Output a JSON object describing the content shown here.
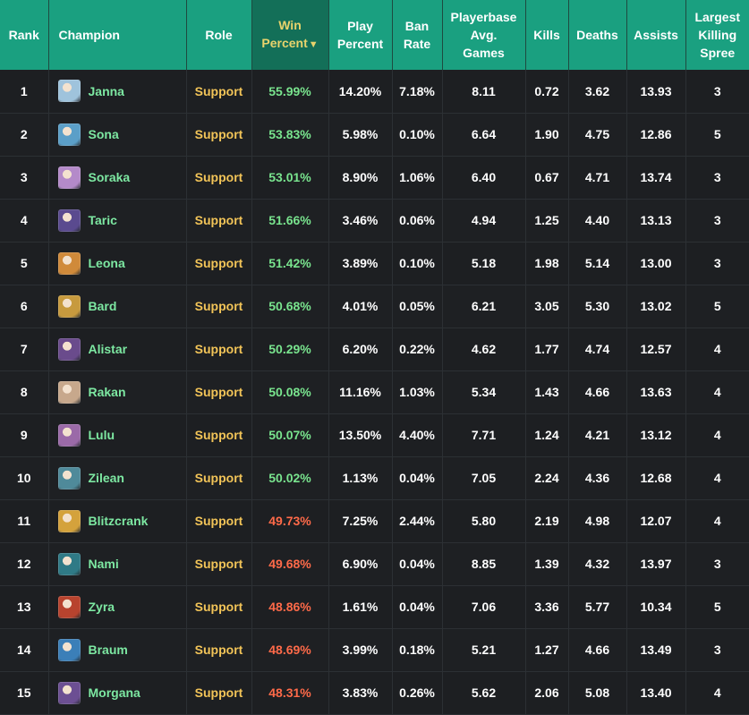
{
  "headers": {
    "rank": "Rank",
    "champion": "Champion",
    "role": "Role",
    "win_line1": "Win",
    "win_line2": "Percent",
    "win_arrow": "▼",
    "play_line1": "Play",
    "play_line2": "Percent",
    "ban_line1": "Ban",
    "ban_line2": "Rate",
    "pb_line1": "Playerbase",
    "pb_line2": "Avg.",
    "pb_line3": "Games",
    "kills": "Kills",
    "deaths": "Deaths",
    "assists": "Assists",
    "spree_line1": "Largest",
    "spree_line2": "Killing",
    "spree_line3": "Spree"
  },
  "colors": {
    "header_bg": "#1aa080",
    "sorted_header_bg": "#136f58",
    "champion_name": "#7de8a2",
    "role": "#f2c458",
    "win_high": "#79e48e",
    "win_low": "#ff6a49"
  },
  "rows": [
    {
      "rank": "1",
      "champion": "Janna",
      "role": "Support",
      "win": "55.99%",
      "win_class": "good",
      "play": "14.20%",
      "ban": "7.18%",
      "games": "8.11",
      "kills": "0.72",
      "deaths": "3.62",
      "assists": "13.93",
      "spree": "3",
      "avatar": "#9fc3dc"
    },
    {
      "rank": "2",
      "champion": "Sona",
      "role": "Support",
      "win": "53.83%",
      "win_class": "good",
      "play": "5.98%",
      "ban": "0.10%",
      "games": "6.64",
      "kills": "1.90",
      "deaths": "4.75",
      "assists": "12.86",
      "spree": "5",
      "avatar": "#5b9fc8"
    },
    {
      "rank": "3",
      "champion": "Soraka",
      "role": "Support",
      "win": "53.01%",
      "win_class": "good",
      "play": "8.90%",
      "ban": "1.06%",
      "games": "6.40",
      "kills": "0.67",
      "deaths": "4.71",
      "assists": "13.74",
      "spree": "3",
      "avatar": "#b48ac9"
    },
    {
      "rank": "4",
      "champion": "Taric",
      "role": "Support",
      "win": "51.66%",
      "win_class": "good",
      "play": "3.46%",
      "ban": "0.06%",
      "games": "4.94",
      "kills": "1.25",
      "deaths": "4.40",
      "assists": "13.13",
      "spree": "3",
      "avatar": "#5a4a8f"
    },
    {
      "rank": "5",
      "champion": "Leona",
      "role": "Support",
      "win": "51.42%",
      "win_class": "good",
      "play": "3.89%",
      "ban": "0.10%",
      "games": "5.18",
      "kills": "1.98",
      "deaths": "5.14",
      "assists": "13.00",
      "spree": "3",
      "avatar": "#d08a3a"
    },
    {
      "rank": "6",
      "champion": "Bard",
      "role": "Support",
      "win": "50.68%",
      "win_class": "good",
      "play": "4.01%",
      "ban": "0.05%",
      "games": "6.21",
      "kills": "3.05",
      "deaths": "5.30",
      "assists": "13.02",
      "spree": "5",
      "avatar": "#c79a3e"
    },
    {
      "rank": "7",
      "champion": "Alistar",
      "role": "Support",
      "win": "50.29%",
      "win_class": "good",
      "play": "6.20%",
      "ban": "0.22%",
      "games": "4.62",
      "kills": "1.77",
      "deaths": "4.74",
      "assists": "12.57",
      "spree": "4",
      "avatar": "#6a4b8c"
    },
    {
      "rank": "8",
      "champion": "Rakan",
      "role": "Support",
      "win": "50.08%",
      "win_class": "good",
      "play": "11.16%",
      "ban": "1.03%",
      "games": "5.34",
      "kills": "1.43",
      "deaths": "4.66",
      "assists": "13.63",
      "spree": "4",
      "avatar": "#c7a88c"
    },
    {
      "rank": "9",
      "champion": "Lulu",
      "role": "Support",
      "win": "50.07%",
      "win_class": "good",
      "play": "13.50%",
      "ban": "4.40%",
      "games": "7.71",
      "kills": "1.24",
      "deaths": "4.21",
      "assists": "13.12",
      "spree": "4",
      "avatar": "#9b6aa8"
    },
    {
      "rank": "10",
      "champion": "Zilean",
      "role": "Support",
      "win": "50.02%",
      "win_class": "good",
      "play": "1.13%",
      "ban": "0.04%",
      "games": "7.05",
      "kills": "2.24",
      "deaths": "4.36",
      "assists": "12.68",
      "spree": "4",
      "avatar": "#4f8a9a"
    },
    {
      "rank": "11",
      "champion": "Blitzcrank",
      "role": "Support",
      "win": "49.73%",
      "win_class": "bad",
      "play": "7.25%",
      "ban": "2.44%",
      "games": "5.80",
      "kills": "2.19",
      "deaths": "4.98",
      "assists": "12.07",
      "spree": "4",
      "avatar": "#d4a23c"
    },
    {
      "rank": "12",
      "champion": "Nami",
      "role": "Support",
      "win": "49.68%",
      "win_class": "bad",
      "play": "6.90%",
      "ban": "0.04%",
      "games": "8.85",
      "kills": "1.39",
      "deaths": "4.32",
      "assists": "13.97",
      "spree": "3",
      "avatar": "#2f7a86"
    },
    {
      "rank": "13",
      "champion": "Zyra",
      "role": "Support",
      "win": "48.86%",
      "win_class": "bad",
      "play": "1.61%",
      "ban": "0.04%",
      "games": "7.06",
      "kills": "3.36",
      "deaths": "5.77",
      "assists": "10.34",
      "spree": "5",
      "avatar": "#b8432e"
    },
    {
      "rank": "14",
      "champion": "Braum",
      "role": "Support",
      "win": "48.69%",
      "win_class": "bad",
      "play": "3.99%",
      "ban": "0.18%",
      "games": "5.21",
      "kills": "1.27",
      "deaths": "4.66",
      "assists": "13.49",
      "spree": "3",
      "avatar": "#3b7fb8"
    },
    {
      "rank": "15",
      "champion": "Morgana",
      "role": "Support",
      "win": "48.31%",
      "win_class": "bad",
      "play": "3.83%",
      "ban": "0.26%",
      "games": "5.62",
      "kills": "2.06",
      "deaths": "5.08",
      "assists": "13.40",
      "spree": "4",
      "avatar": "#6c4f93"
    }
  ]
}
